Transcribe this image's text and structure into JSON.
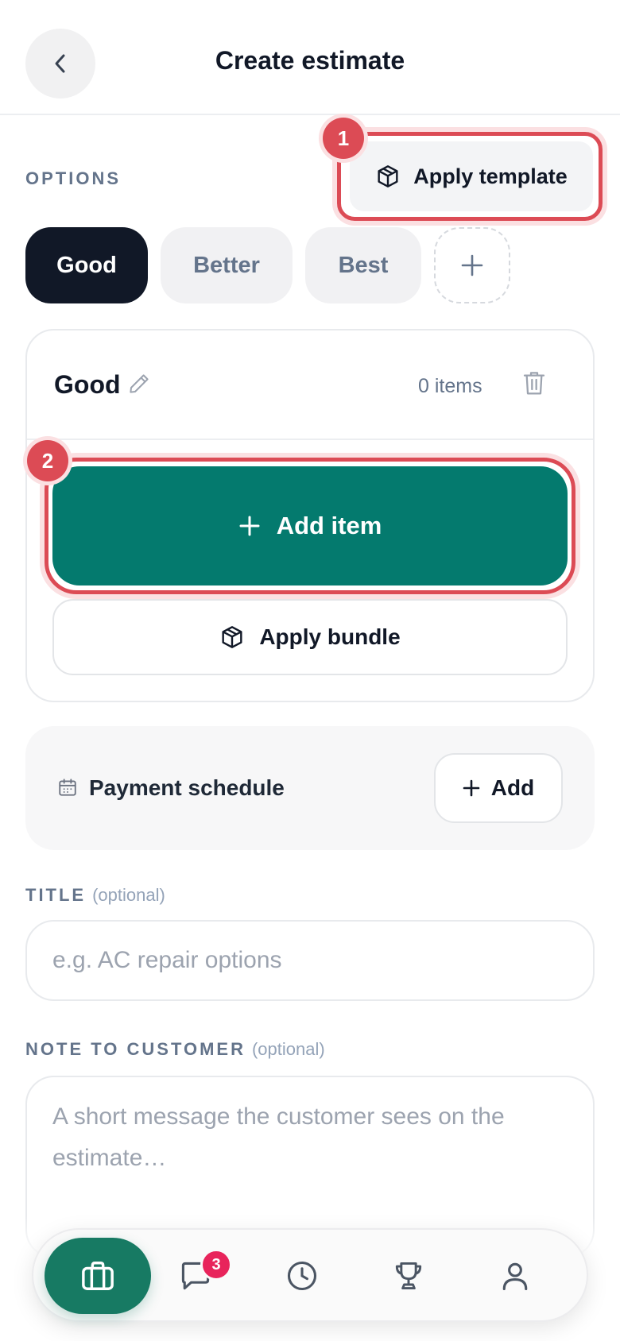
{
  "header": {
    "title": "Create estimate"
  },
  "options": {
    "label": "OPTIONS",
    "apply_template": "Apply template",
    "tabs": [
      {
        "label": "Good",
        "active": true
      },
      {
        "label": "Better",
        "active": false
      },
      {
        "label": "Best",
        "active": false
      }
    ]
  },
  "annotations": {
    "step1": "1",
    "step2": "2"
  },
  "card": {
    "title": "Good",
    "items_count": "0 items",
    "add_item": "Add item",
    "apply_bundle": "Apply bundle"
  },
  "payment": {
    "label": "Payment schedule",
    "add": "Add"
  },
  "title_field": {
    "label": "TITLE",
    "optional": "(optional)",
    "placeholder": "e.g. AC repair options"
  },
  "note_field": {
    "label": "NOTE TO CUSTOMER",
    "optional": "(optional)",
    "placeholder": "A short message the customer sees on the estimate…"
  },
  "nav": {
    "messages_badge": "3",
    "items": [
      "briefcase-icon",
      "chat-icon",
      "clock-icon",
      "trophy-icon",
      "user-icon"
    ]
  },
  "colors": {
    "accent_teal": "#047a6e",
    "nav_active": "#177a63",
    "highlight_red": "#dc4b55",
    "badge_pink": "#e8245b",
    "dark": "#111827"
  }
}
